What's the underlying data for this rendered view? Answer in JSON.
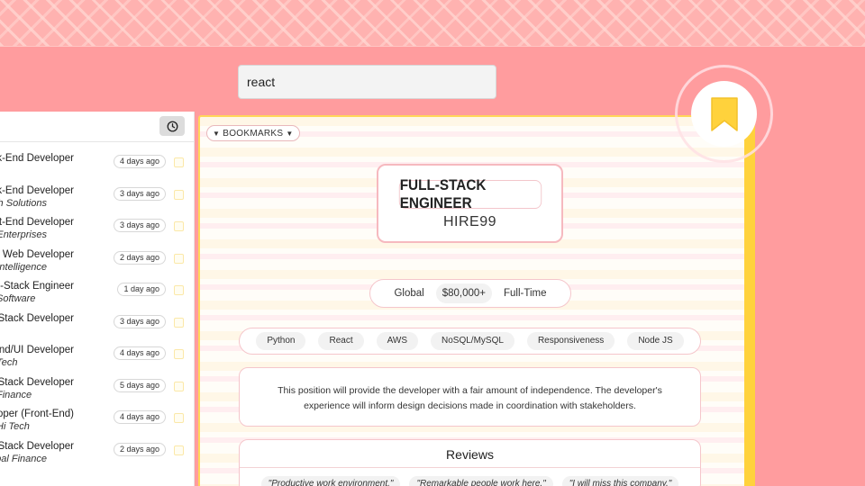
{
  "search": {
    "value": "react"
  },
  "list": {
    "items": [
      {
        "title": "Back-End Developer",
        "company": "",
        "age": "4 days ago"
      },
      {
        "title": "Back-End Developer",
        "company": "Tech Solutions",
        "age": "3 days ago"
      },
      {
        "title": "Front-End Developer",
        "company": "XYZ Enterprises",
        "age": "3 days ago"
      },
      {
        "title": "Front-End Web Developer",
        "company": "AI Intelligence",
        "age": "2 days ago"
      },
      {
        "title": "Full-Stack Engineer",
        "company": "Software",
        "age": "1 day ago"
      },
      {
        "title": "Full-Stack Developer",
        "company": "",
        "age": "3 days ago"
      },
      {
        "title": "Front-End/UI Developer",
        "company": "Tech",
        "age": "4 days ago"
      },
      {
        "title": "Full-Stack Developer",
        "company": "Finance",
        "age": "5 days ago"
      },
      {
        "title": "Web Developer (Front-End)",
        "company": "Hi Tech",
        "age": "4 days ago"
      },
      {
        "title": "Full-Stack Developer",
        "company": "Global Finance",
        "age": "2 days ago"
      }
    ]
  },
  "card": {
    "bookmarks_label": "BOOKMARKS",
    "title": "FULL-STACK ENGINEER",
    "company": "HIRE99",
    "location": "Global",
    "salary": "$80,000+",
    "type": "Full-Time",
    "skills": [
      "Python",
      "React",
      "AWS",
      "NoSQL/MySQL",
      "Responsiveness",
      "Node JS"
    ],
    "description": "This position will provide the developer with a fair amount of independence. The developer's experience will inform design decisions made in coordination with stakeholders.",
    "reviews_heading": "Reviews",
    "reviews": [
      "\"Productive work environment.\"",
      "\"Remarkable people work here.\"",
      "\"I will miss this company.\""
    ]
  },
  "colors": {
    "background": "#ff9c9e",
    "accent_yellow": "#ffd23c",
    "card_border_pink": "#f5c6cb"
  },
  "icons": {
    "history": "clock-icon",
    "bookmark": "bookmark-icon",
    "dropdown": "triangle-down-icon"
  }
}
